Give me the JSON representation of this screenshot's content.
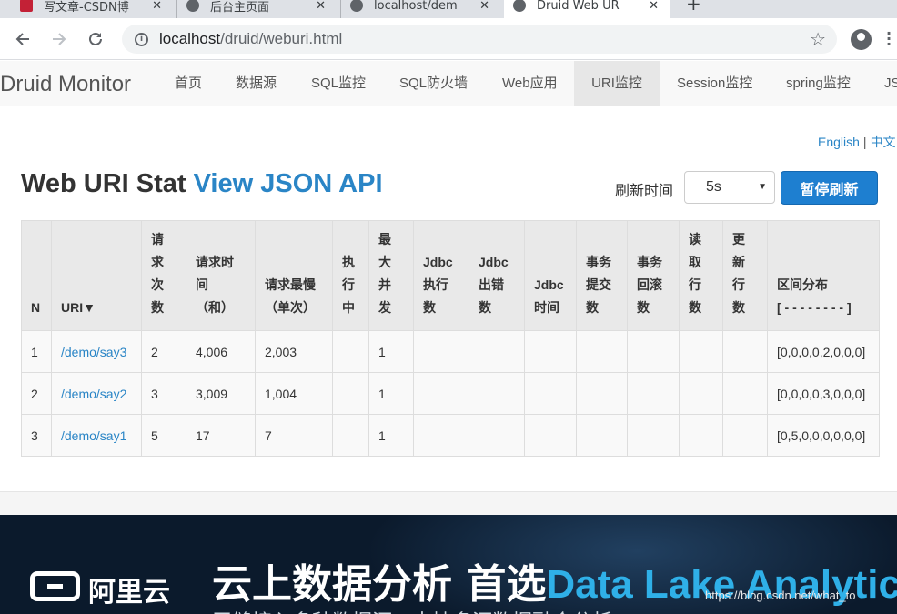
{
  "browser": {
    "tabs": [
      {
        "label": "写文章-CSDN博",
        "icon": "csdn-icon"
      },
      {
        "label": "后台主页面",
        "icon": "globe-icon"
      },
      {
        "label": "localhost/dem",
        "icon": "globe-icon"
      },
      {
        "label": "Druid Web UR",
        "icon": "globe-icon"
      }
    ],
    "close_glyph": "✕",
    "newtab_glyph": "+",
    "url_host": "localhost",
    "url_path": "/druid/weburi.html"
  },
  "nav": {
    "brand": "Druid Monitor",
    "items": [
      "首页",
      "数据源",
      "SQL监控",
      "SQL防火墙",
      "Web应用",
      "URI监控",
      "Session监控",
      "spring监控",
      "JS"
    ],
    "active_index": 5
  },
  "lang": {
    "english": "English",
    "sep": "|",
    "chinese": "中文"
  },
  "title": {
    "main": "Web URI Stat",
    "api": "View JSON API"
  },
  "refresh": {
    "label": "刷新时间",
    "selected": "5s",
    "pause_label": "暂停刷新"
  },
  "table": {
    "headers": [
      [
        "N"
      ],
      [
        "URI▼"
      ],
      [
        "请",
        "求",
        "次",
        "数"
      ],
      [
        "请求时",
        "间",
        "（和）"
      ],
      [
        "请求最慢",
        "（单次）"
      ],
      [
        "执",
        "行",
        "中"
      ],
      [
        "最",
        "大",
        "并",
        "发"
      ],
      [
        "Jdbc",
        "执行",
        "数"
      ],
      [
        "Jdbc",
        "出错",
        "数"
      ],
      [
        "Jdbc",
        "时间"
      ],
      [
        "事务",
        "提交",
        "数"
      ],
      [
        "事务",
        "回滚",
        "数"
      ],
      [
        "读",
        "取",
        "行",
        "数"
      ],
      [
        "更",
        "新",
        "行",
        "数"
      ],
      [
        "区间分布",
        "[ - - - - - - - - ]"
      ]
    ],
    "rows": [
      [
        "1",
        "/demo/say3",
        "2",
        "4,006",
        "2,003",
        "",
        "1",
        "",
        "",
        "",
        "",
        "",
        "",
        "",
        "[0,0,0,0,2,0,0,0]"
      ],
      [
        "2",
        "/demo/say2",
        "3",
        "3,009",
        "1,004",
        "",
        "1",
        "",
        "",
        "",
        "",
        "",
        "",
        "",
        "[0,0,0,0,3,0,0,0]"
      ],
      [
        "3",
        "/demo/say1",
        "5",
        "17",
        "7",
        "",
        "1",
        "",
        "",
        "",
        "",
        "",
        "",
        "",
        "[0,5,0,0,0,0,0,0]"
      ]
    ]
  },
  "banner": {
    "logo_text": "阿里云",
    "title_cn": "云上数据分析 首选",
    "title_en": "Data Lake Analytics",
    "subtitle": "无缝接入多种数据源，支持多源数据融合分析"
  },
  "watermark": "https://blog.csdn.net/what_to"
}
